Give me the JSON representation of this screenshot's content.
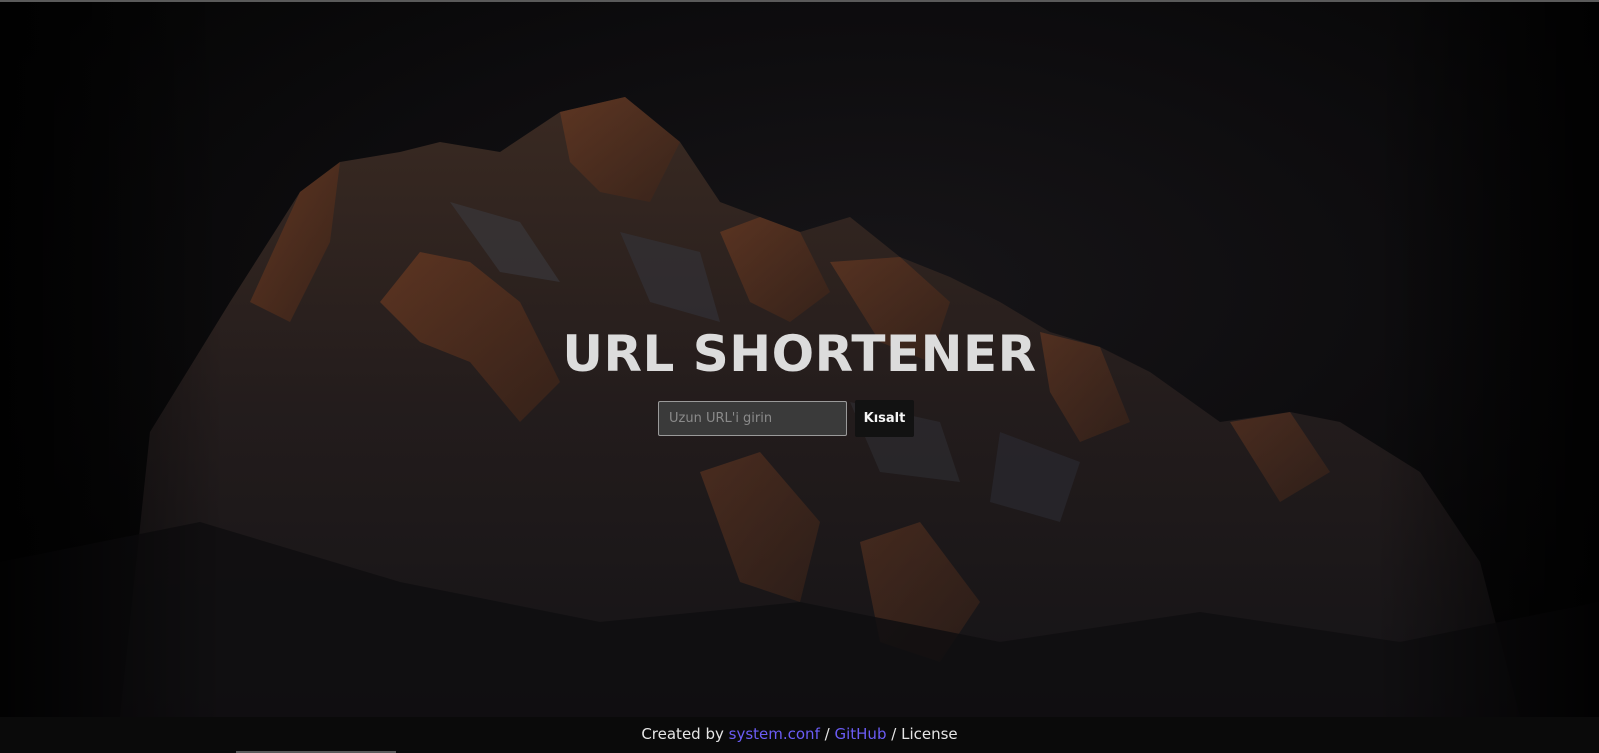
{
  "page": {
    "title": "URL SHORTENER"
  },
  "form": {
    "input_placeholder": "Uzun URL'i girin",
    "input_value": "",
    "submit_label": "Kısalt"
  },
  "footer": {
    "created_by": "Created by",
    "author_link": "system.conf",
    "separator_1": "/",
    "github_link": "GitHub",
    "separator_2": "/",
    "license_text": "License"
  },
  "colors": {
    "background": "#050505",
    "title_text": "#dcdcdc",
    "link": "#6b5cf5",
    "mountain_light": "#8a4a2a",
    "mountain_dark": "#1a1a1e"
  }
}
